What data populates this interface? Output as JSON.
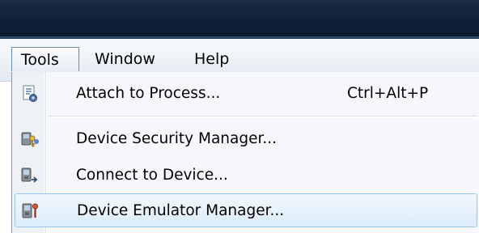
{
  "menubar": {
    "items": [
      {
        "label": "Tools"
      },
      {
        "label": "Window"
      },
      {
        "label": "Help"
      }
    ]
  },
  "tools_menu": {
    "items": [
      {
        "label": "Attach to Process...",
        "shortcut": "Ctrl+Alt+P",
        "icon": "attach-process-icon"
      },
      {
        "label": "Device Security Manager...",
        "shortcut": "",
        "icon": "device-security-icon"
      },
      {
        "label": "Connect to Device...",
        "shortcut": "",
        "icon": "connect-device-icon"
      },
      {
        "label": "Device Emulator Manager...",
        "shortcut": "",
        "icon": "emulator-manager-icon",
        "highlighted": true
      }
    ]
  },
  "colors": {
    "titlebar": "#0f2039",
    "highlight_border": "#9ac5ee",
    "highlight_fill": "#dcecfb"
  }
}
